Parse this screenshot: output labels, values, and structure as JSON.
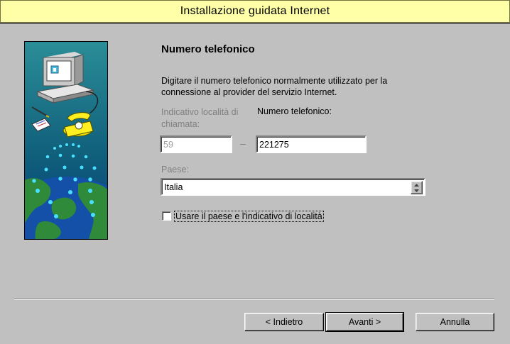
{
  "window": {
    "title": "Installazione guidata Internet"
  },
  "page": {
    "heading": "Numero telefonico",
    "description": "Digitare il numero telefonico normalmente utilizzato per la connessione al provider del servizio Internet.",
    "area_code_label": "Indicativo località di chiamata:",
    "phone_label": "Numero telefonico:",
    "area_code_value": "59",
    "phone_value": "221275",
    "separator": "–",
    "country_label": "Paese:",
    "country_value": "Italia",
    "checkbox_label": "Usare il paese e l'indicativo di località",
    "checkbox_checked": false
  },
  "buttons": {
    "back": "< Indietro",
    "next": "Avanti >",
    "cancel": "Annulla"
  }
}
